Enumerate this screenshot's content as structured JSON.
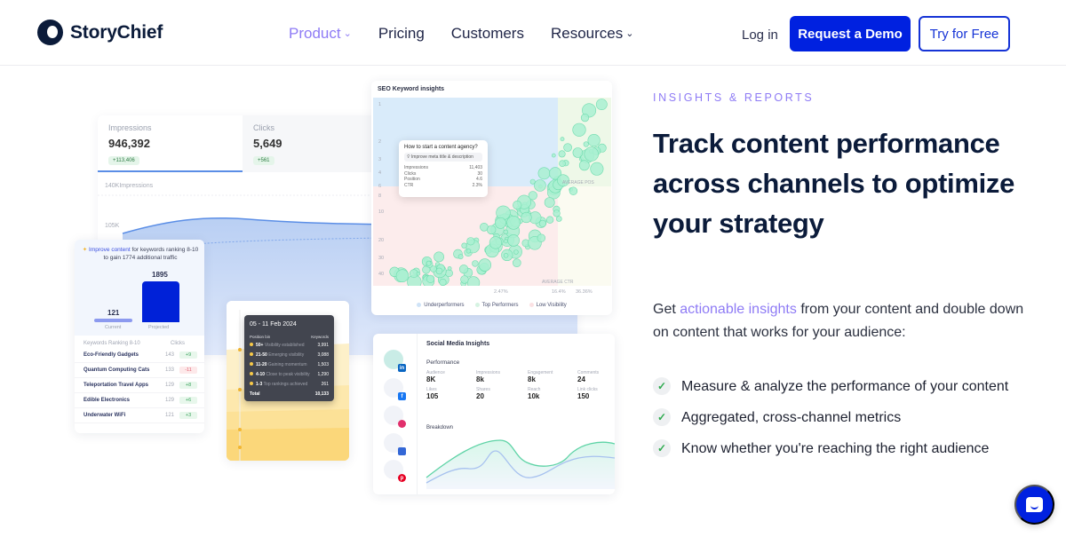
{
  "nav": {
    "brand": "StoryChief",
    "links": [
      {
        "label": "Product",
        "dropdown": true,
        "active": true
      },
      {
        "label": "Pricing",
        "dropdown": false
      },
      {
        "label": "Customers",
        "dropdown": false
      },
      {
        "label": "Resources",
        "dropdown": true
      }
    ],
    "login": "Log in",
    "demo": "Request a Demo",
    "free": "Try for Free",
    "chevron": "⌄"
  },
  "colors": {
    "accent": "#8e7bf5",
    "primary": "#0021e0",
    "headline": "#0b1b3a",
    "check": "#2eaa4f"
  },
  "impressions": {
    "metrics": [
      {
        "label": "Impressions",
        "value": "946,392",
        "delta": "+113,406"
      },
      {
        "label": "Clicks",
        "value": "5,649",
        "delta": "+561"
      }
    ],
    "axis_top": "140KImpressions",
    "axis_mid": "105K"
  },
  "keywords": {
    "message_prefix": "Improve content",
    "message_rest": " for keywords ranking 8-10 to gain 1774 additional traffic",
    "current_value": "121",
    "current_label": "Current",
    "projected_value": "1895",
    "projected_label": "Projected",
    "col_name": "Keywords Ranking 8-10",
    "col_clicks": "Clicks",
    "rows": [
      {
        "name": "Eco-Friendly Gadgets",
        "clicks": "143",
        "delta": "+9",
        "positive": true
      },
      {
        "name": "Quantum Computing Cats",
        "clicks": "133",
        "delta": "-11",
        "positive": false
      },
      {
        "name": "Teleportation Travel Apps",
        "clicks": "129",
        "delta": "+8",
        "positive": true
      },
      {
        "name": "Edible Electronics",
        "clicks": "129",
        "delta": "+6",
        "positive": true
      },
      {
        "name": "Underwater WiFi",
        "clicks": "121",
        "delta": "+3",
        "positive": true
      }
    ]
  },
  "positions": {
    "title": "05 - 11 Feb 2024",
    "col_bin": "Position bin",
    "col_kw": "Keywords",
    "rows": [
      {
        "bin": "50+",
        "desc": "Visibility established",
        "value": "3,991"
      },
      {
        "bin": "21-50",
        "desc": "Emerging visibility",
        "value": "3,088"
      },
      {
        "bin": "11-20",
        "desc": "Gaining momentum",
        "value": "1,503"
      },
      {
        "bin": "4-10",
        "desc": "Close to peak visibility",
        "value": "1,290"
      },
      {
        "bin": "1-3",
        "desc": "Top rankings achieved",
        "value": "261"
      }
    ],
    "total_label": "Total",
    "total_value": "10,133"
  },
  "seo": {
    "title": "SEO Keyword insights",
    "y_ticks": [
      "1",
      "2",
      "3",
      "4",
      "6",
      "8",
      "10",
      "20",
      "30",
      "40"
    ],
    "x_ticks": [
      "2.47%",
      "16.4%",
      "36.36%"
    ],
    "avg_pos": "AVERAGE POS",
    "avg_ctr": "AVERAGE CTR",
    "legend": [
      {
        "label": "Underperformers",
        "color": "#cfe3f7"
      },
      {
        "label": "Top Performers",
        "color": "#d6f3e2"
      },
      {
        "label": "Low Visibility",
        "color": "#fbe1e3"
      }
    ],
    "tooltip": {
      "question": "How to start a content agency?",
      "tip": "Improve meta title & description",
      "rows": [
        {
          "k": "Impressions",
          "v": "11,403"
        },
        {
          "k": "Clicks",
          "v": "30"
        },
        {
          "k": "Position",
          "v": "4.6"
        },
        {
          "k": "CTR",
          "v": "2.3%"
        }
      ]
    }
  },
  "social": {
    "title": "Social Media Insights",
    "performance": "Performance",
    "metrics": [
      {
        "k": "Audience",
        "v": "8K"
      },
      {
        "k": "Impressions",
        "v": "8k"
      },
      {
        "k": "Engagement",
        "v": "8k"
      },
      {
        "k": "Comments",
        "v": "24"
      },
      {
        "k": "Likes",
        "v": "105"
      },
      {
        "k": "Shares",
        "v": "20"
      },
      {
        "k": "Reach",
        "v": "10k"
      },
      {
        "k": "Link clicks",
        "v": "150"
      }
    ],
    "breakdown": "Breakdown",
    "channels": [
      "linkedin",
      "facebook",
      "instagram",
      "google-business",
      "pinterest"
    ]
  },
  "hero": {
    "eyebrow": "INSIGHTS & REPORTS",
    "headline": "Track content performance across channels to optimize your strategy",
    "lead_prefix": "Get ",
    "lead_link": "actionable insights",
    "lead_suffix": " from your content and double down on content that works for your audience:",
    "bullets": [
      "Measure & analyze the performance of your content",
      "Aggregated, cross-channel metrics",
      "Know whether you're reaching the right audience"
    ],
    "check_glyph": "✓"
  }
}
